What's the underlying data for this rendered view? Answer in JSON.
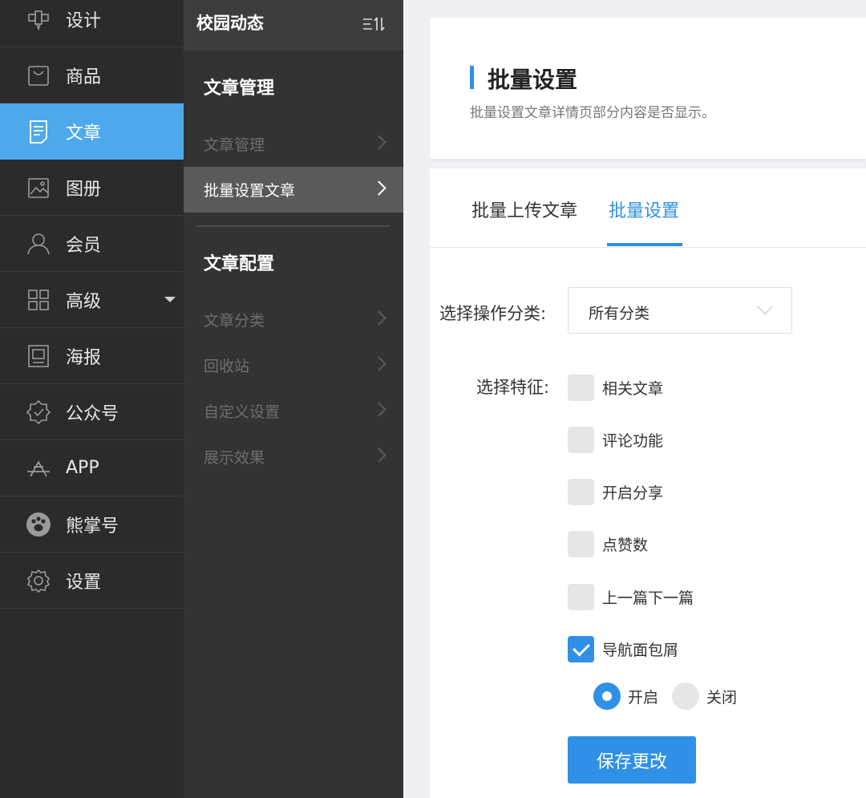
{
  "sidebar": {
    "items": [
      {
        "label": "设计",
        "icon": "design-icon"
      },
      {
        "label": "商品",
        "icon": "bag-icon"
      },
      {
        "label": "文章",
        "icon": "document-icon"
      },
      {
        "label": "图册",
        "icon": "image-icon"
      },
      {
        "label": "会员",
        "icon": "user-icon"
      },
      {
        "label": "高级",
        "icon": "grid-icon"
      },
      {
        "label": "海报",
        "icon": "poster-icon"
      },
      {
        "label": "公众号",
        "icon": "badge-icon"
      },
      {
        "label": "APP",
        "icon": "app-store-icon"
      },
      {
        "label": "熊掌号",
        "icon": "paw-icon"
      },
      {
        "label": "设置",
        "icon": "gear-icon"
      }
    ],
    "active_index": 2
  },
  "subnav": {
    "title": "校园动态",
    "groups": [
      {
        "title": "文章管理",
        "items": [
          "文章管理",
          "批量设置文章"
        ]
      },
      {
        "title": "文章配置",
        "items": [
          "文章分类",
          "回收站",
          "自定义设置",
          "展示效果"
        ]
      }
    ],
    "active_item": "批量设置文章"
  },
  "header": {
    "title": "批量设置",
    "description": "批量设置文章详情页部分内容是否显示。"
  },
  "tabs": [
    {
      "label": "批量上传文章"
    },
    {
      "label": "批量设置"
    }
  ],
  "active_tab": 1,
  "form": {
    "category_label": "选择操作分类:",
    "category_value": "所有分类",
    "feature_label": "选择特征:",
    "features": [
      {
        "label": "相关文章",
        "checked": false
      },
      {
        "label": "评论功能",
        "checked": false
      },
      {
        "label": "开启分享",
        "checked": false
      },
      {
        "label": "点赞数",
        "checked": false
      },
      {
        "label": "上一篇下一篇",
        "checked": false
      },
      {
        "label": "导航面包屑",
        "checked": true
      }
    ],
    "radio_on": "开启",
    "radio_off": "关闭",
    "radio_selected": "开启",
    "save_label": "保存更改"
  },
  "colors": {
    "accent": "#2e90e6",
    "sidebar_active": "#4da9ec",
    "sidebar_bg": "#2b2b2b",
    "subnav_bg": "#333333"
  }
}
